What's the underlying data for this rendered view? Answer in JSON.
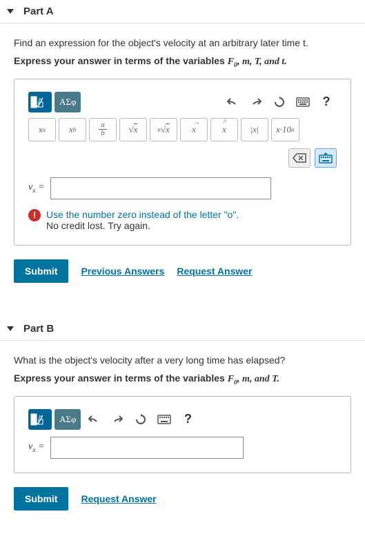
{
  "partA": {
    "title": "Part A",
    "question": "Find an expression for the object's velocity at an arbitrary later time t.",
    "hint_pre": "Express your answer in terms of the variables ",
    "hint_vars": "F₀, m, T, and t.",
    "math_btns": {
      "xa": "xᵃ",
      "xb": "xᵦ",
      "ab": "a/b",
      "sqrt": "√x",
      "nroot": "ⁿ√x",
      "vec": "x⃗",
      "hat": "x̂",
      "abs": "|x|",
      "sci": "x·10ⁿ"
    },
    "greek": "ΑΣφ",
    "lhs": "vₓ =",
    "error_l1": "Use the number zero instead of the letter \"o\".",
    "error_l2": "No credit lost. Try again.",
    "submit": "Submit",
    "prev": "Previous Answers",
    "req": "Request Answer",
    "help": "?"
  },
  "partB": {
    "title": "Part B",
    "question": "What is the object's velocity after a very long time has elapsed?",
    "hint_pre": "Express your answer in terms of the variables ",
    "hint_vars": "F₀, m, and T.",
    "greek": "ΑΣφ",
    "lhs": "vₓ =",
    "submit": "Submit",
    "req": "Request Answer",
    "help": "?"
  }
}
